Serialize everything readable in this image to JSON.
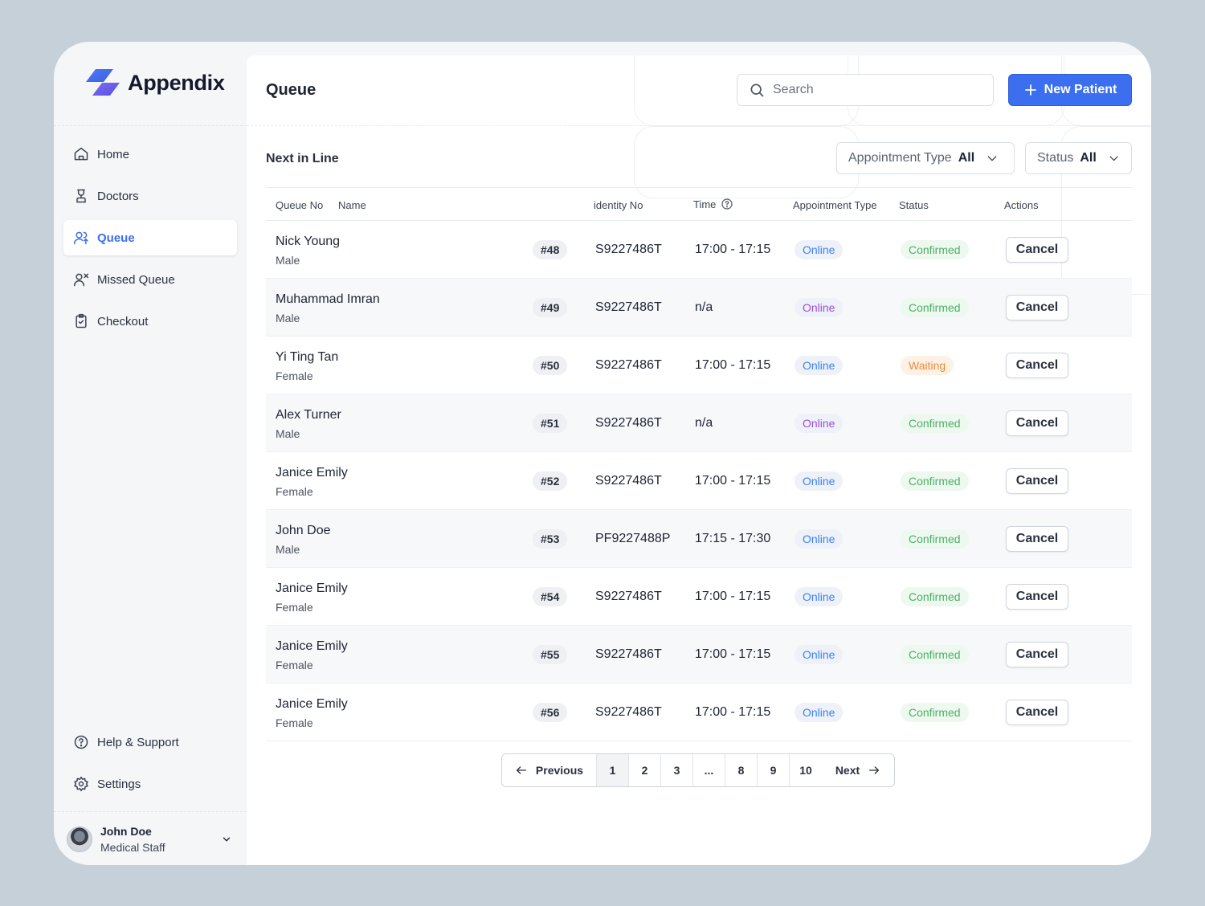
{
  "brand": {
    "name": "Appendix"
  },
  "sidebar": {
    "items": [
      {
        "label": "Home",
        "icon": "home-icon",
        "active": false
      },
      {
        "label": "Doctors",
        "icon": "doctor-icon",
        "active": false
      },
      {
        "label": "Queue",
        "icon": "queue-users-icon",
        "active": true
      },
      {
        "label": "Missed Queue",
        "icon": "user-x-icon",
        "active": false
      },
      {
        "label": "Checkout",
        "icon": "clipboard-check-icon",
        "active": false
      }
    ],
    "bottom": [
      {
        "label": "Help & Support",
        "icon": "help-circle-icon"
      },
      {
        "label": "Settings",
        "icon": "gear-icon"
      }
    ],
    "user": {
      "name": "John Doe",
      "role": "Medical Staff"
    }
  },
  "header": {
    "title": "Queue",
    "search_placeholder": "Search",
    "new_button_label": "New Patient"
  },
  "section": {
    "title": "Next in Line",
    "filters": [
      {
        "label": "Appointment Type",
        "value": "All"
      },
      {
        "label": "Status",
        "value": "All"
      }
    ]
  },
  "table": {
    "columns": [
      "Queue No",
      "Name",
      "identity No",
      "Time",
      "Appointment Type",
      "Status",
      "Actions"
    ],
    "rows": [
      {
        "name": "Nick Young",
        "gender": "Male",
        "queue_no": "#48",
        "identity": "S9227486T",
        "time": "17:00 - 17:15",
        "appointment": "Online",
        "appt_color": "#3b82f6",
        "status": "Confirmed",
        "status_type": "confirmed",
        "action": "Cancel"
      },
      {
        "name": "Muhammad Imran",
        "gender": "Male",
        "queue_no": "#49",
        "identity": "S9227486T",
        "time": "n/a",
        "appointment": "Online",
        "appt_color": "#9b4fd8",
        "status": "Confirmed",
        "status_type": "confirmed",
        "action": "Cancel"
      },
      {
        "name": "Yi Ting Tan",
        "gender": "Female",
        "queue_no": "#50",
        "identity": "S9227486T",
        "time": "17:00 - 17:15",
        "appointment": "Online",
        "appt_color": "#3b82f6",
        "status": "Waiting",
        "status_type": "waiting",
        "action": "Cancel"
      },
      {
        "name": "Alex Turner",
        "gender": "Male",
        "queue_no": "#51",
        "identity": "S9227486T",
        "time": "n/a",
        "appointment": "Online",
        "appt_color": "#9b4fd8",
        "status": "Confirmed",
        "status_type": "confirmed",
        "action": "Cancel"
      },
      {
        "name": "Janice Emily",
        "gender": "Female",
        "queue_no": "#52",
        "identity": "S9227486T",
        "time": "17:00 - 17:15",
        "appointment": "Online",
        "appt_color": "#3b82f6",
        "status": "Confirmed",
        "status_type": "confirmed",
        "action": "Cancel"
      },
      {
        "name": "John Doe",
        "gender": "Male",
        "queue_no": "#53",
        "identity": "PF9227488P",
        "time": "17:15 - 17:30",
        "appointment": "Online",
        "appt_color": "#3b82f6",
        "status": "Confirmed",
        "status_type": "confirmed",
        "action": "Cancel"
      },
      {
        "name": "Janice Emily",
        "gender": "Female",
        "queue_no": "#54",
        "identity": "S9227486T",
        "time": "17:00 - 17:15",
        "appointment": "Online",
        "appt_color": "#3b82f6",
        "status": "Confirmed",
        "status_type": "confirmed",
        "action": "Cancel"
      },
      {
        "name": "Janice Emily",
        "gender": "Female",
        "queue_no": "#55",
        "identity": "S9227486T",
        "time": "17:00 - 17:15",
        "appointment": "Online",
        "appt_color": "#3b82f6",
        "status": "Confirmed",
        "status_type": "confirmed",
        "action": "Cancel"
      },
      {
        "name": "Janice Emily",
        "gender": "Female",
        "queue_no": "#56",
        "identity": "S9227486T",
        "time": "17:00 - 17:15",
        "appointment": "Online",
        "appt_color": "#3b82f6",
        "status": "Confirmed",
        "status_type": "confirmed",
        "action": "Cancel"
      }
    ]
  },
  "pagination": {
    "previous": "Previous",
    "next": "Next",
    "pages": [
      "1",
      "2",
      "3",
      "...",
      "8",
      "9",
      "10"
    ],
    "current": "1"
  }
}
